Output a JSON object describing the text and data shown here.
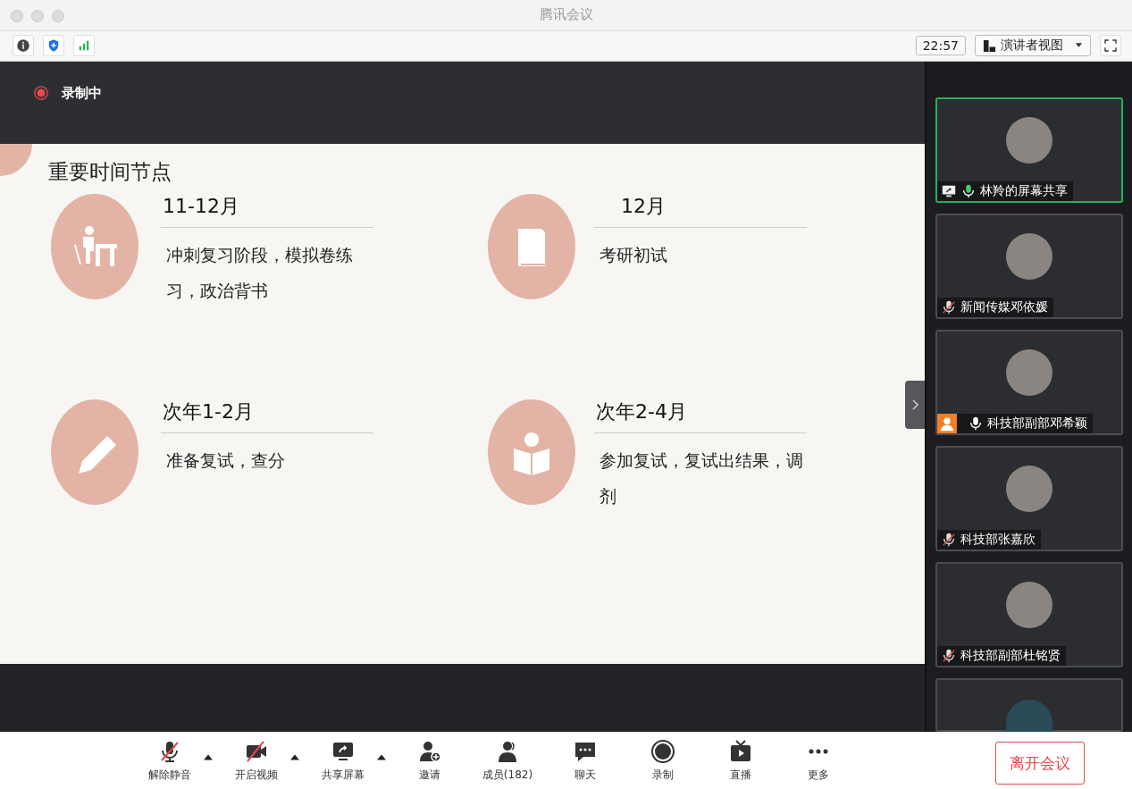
{
  "window": {
    "title": "腾讯会议"
  },
  "toolbar": {
    "time": "22:57",
    "view": "演讲者视图"
  },
  "recording": {
    "label": "录制中"
  },
  "slide": {
    "title": "重要时间节点",
    "items": [
      {
        "kind": "desk",
        "heading": "11-12月",
        "text": "冲刺复习阶段，模拟卷练习，政治背书"
      },
      {
        "kind": "book",
        "heading": "12月",
        "text": "考研初试"
      },
      {
        "kind": "pencil",
        "heading": "次年1-2月",
        "text": "准备复试，查分"
      },
      {
        "kind": "reader",
        "heading": "次年2-4月",
        "text": "参加复试，复试出结果，调剂"
      }
    ]
  },
  "participants": [
    {
      "name": "林羚的屏幕共享",
      "muted": false,
      "sharing": true,
      "video_off": false,
      "speaking": true
    },
    {
      "name": "新闻传媒邓依媛",
      "muted": true,
      "sharing": false,
      "video_off": false,
      "speaking": false
    },
    {
      "name": "科技部副部邓希颖",
      "muted": false,
      "sharing": false,
      "video_off": true,
      "speaking": false
    },
    {
      "name": "科技部张嘉欣",
      "muted": true,
      "sharing": false,
      "video_off": false,
      "speaking": false
    },
    {
      "name": "科技部副部杜铭贤",
      "muted": true,
      "sharing": false,
      "video_off": false,
      "speaking": false
    }
  ],
  "controls": [
    {
      "kind": "mic-off",
      "label": "解除静音",
      "caret": true
    },
    {
      "kind": "video-off",
      "label": "开启视频",
      "caret": true
    },
    {
      "kind": "share",
      "label": "共享屏幕",
      "caret": true
    },
    {
      "kind": "invite",
      "label": "邀请",
      "caret": false
    },
    {
      "kind": "members",
      "label": "成员(182)",
      "caret": false
    },
    {
      "kind": "chat",
      "label": "聊天",
      "caret": false
    },
    {
      "kind": "record",
      "label": "录制",
      "caret": false
    },
    {
      "kind": "live",
      "label": "直播",
      "caret": false
    },
    {
      "kind": "more",
      "label": "更多",
      "caret": false
    }
  ],
  "leave_button": "离开会议"
}
